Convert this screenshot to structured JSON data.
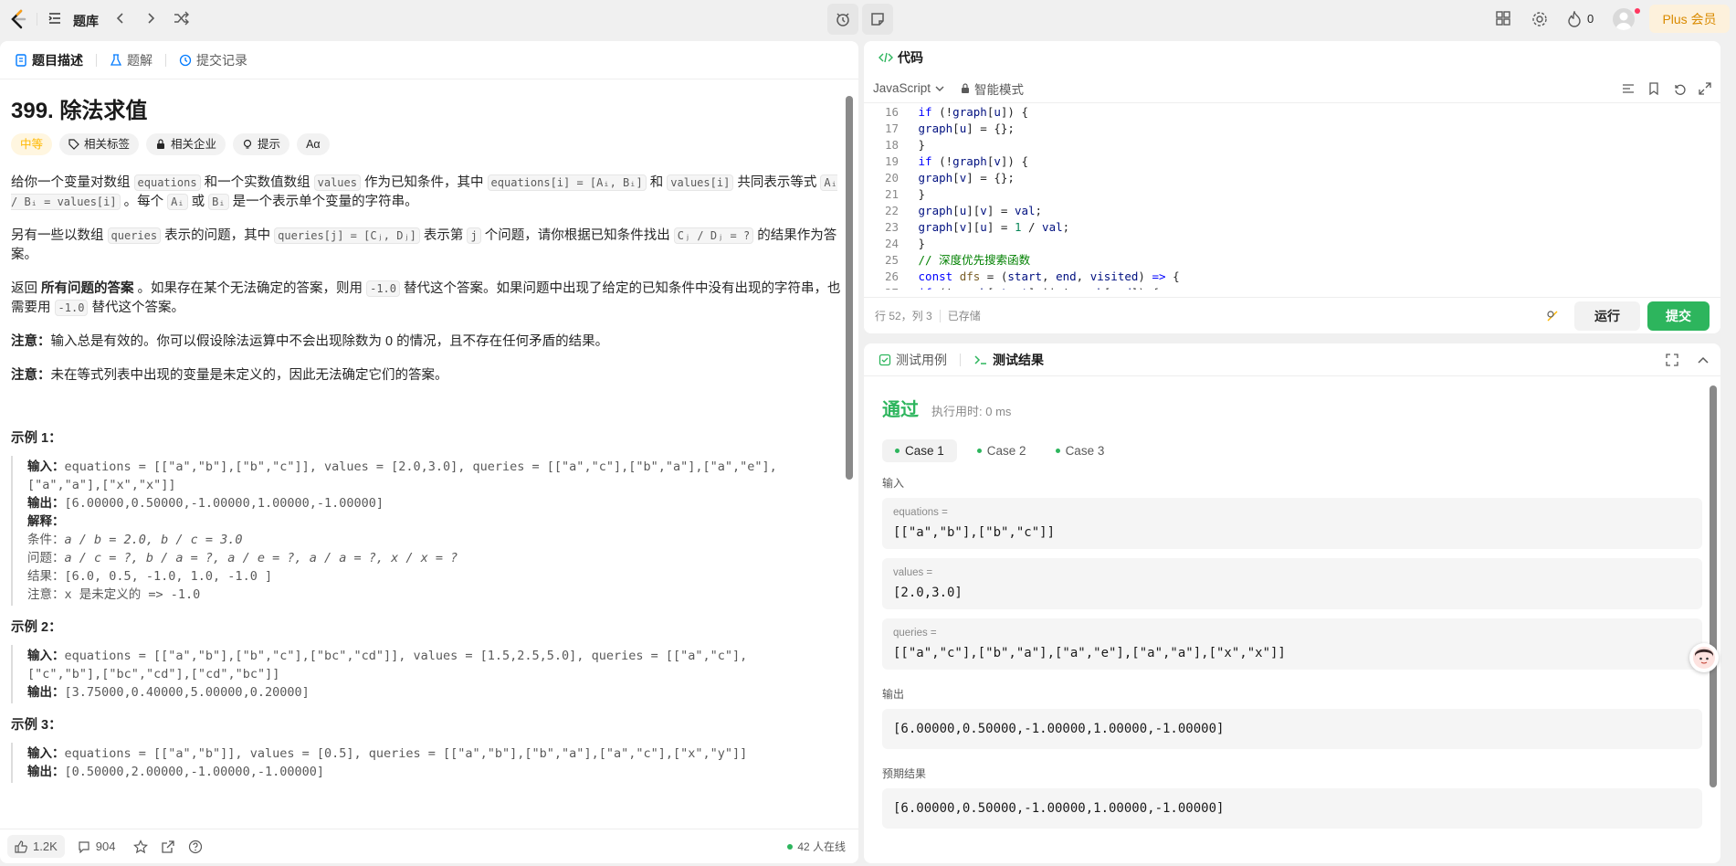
{
  "topbar": {
    "problem_list": "题库",
    "streak_count": "0",
    "premium": "Plus 会员"
  },
  "left": {
    "tabs": [
      "题目描述",
      "题解",
      "提交记录"
    ],
    "title": "399. 除法求值",
    "tags": [
      "中等",
      "相关标签",
      "相关企业",
      "提示",
      "Aα"
    ],
    "desc": {
      "p1_a": "给你一个变量对数组 ",
      "p1_b": "equations",
      "p1_c": " 和一个实数值数组 ",
      "p1_d": "values",
      "p1_e": " 作为已知条件，其中 ",
      "p1_f": "equations[i] = [Aᵢ, Bᵢ]",
      "p1_g": " 和 ",
      "p1_h": "values[i]",
      "p1_i": " 共同表示等式 ",
      "p1_j": "Aᵢ / Bᵢ = values[i]",
      "p1_k": " 。每个 ",
      "p1_l": "Aᵢ",
      "p1_m": " 或 ",
      "p1_n": "Bᵢ",
      "p1_o": " 是一个表示单个变量的字符串。",
      "p2_a": "另有一些以数组 ",
      "p2_b": "queries",
      "p2_c": " 表示的问题，其中 ",
      "p2_d": "queries[j] = [Cⱼ, Dⱼ]",
      "p2_e": " 表示第 ",
      "p2_f": "j",
      "p2_g": " 个问题，请你根据已知条件找出 ",
      "p2_h": "Cⱼ / Dⱼ = ?",
      "p2_i": " 的结果作为答案。",
      "p3_a": "返回 ",
      "p3_b": "所有问题的答案",
      "p3_c": " 。如果存在某个无法确定的答案，则用 ",
      "p3_d": "-1.0",
      "p3_e": " 替代这个答案。如果问题中出现了给定的已知条件中没有出现的字符串，也需要用 ",
      "p3_f": "-1.0",
      "p3_g": " 替代这个答案。",
      "note1_b": "注意：",
      "note1": "输入总是有效的。你可以假设除法运算中不会出现除数为 0 的情况，且不存在任何矛盾的结果。",
      "note2_b": "注意：",
      "note2": "未在等式列表中出现的变量是未定义的，因此无法确定它们的答案。"
    },
    "examples": [
      {
        "title": "示例 1：",
        "input_label": "输入：",
        "input": "equations = [[\"a\",\"b\"],[\"b\",\"c\"]], values = [2.0,3.0], queries = [[\"a\",\"c\"],[\"b\",\"a\"],[\"a\",\"e\"],",
        "input2": "[\"a\",\"a\"],[\"x\",\"x\"]]",
        "output_label": "输出：",
        "output": "[6.00000,0.50000,-1.00000,1.00000,-1.00000]",
        "expl_label": "解释：",
        "l1": "条件：",
        "l1v": "a / b = 2.0, b / c = 3.0",
        "l2": "问题：",
        "l2v": "a / c = ?, b / a = ?, a / e = ?, a / a = ?, x / x = ?",
        "l3": "结果：[6.0, 0.5, -1.0, 1.0, -1.0 ]",
        "l4": "注意：x 是未定义的 => -1.0"
      },
      {
        "title": "示例 2：",
        "input_label": "输入：",
        "input": "equations = [[\"a\",\"b\"],[\"b\",\"c\"],[\"bc\",\"cd\"]], values = [1.5,2.5,5.0], queries = [[\"a\",\"c\"],",
        "input2": "[\"c\",\"b\"],[\"bc\",\"cd\"],[\"cd\",\"bc\"]]",
        "output_label": "输出：",
        "output": "[3.75000,0.40000,5.00000,0.20000]"
      },
      {
        "title": "示例 3：",
        "input_label": "输入：",
        "input": "equations = [[\"a\",\"b\"]], values = [0.5], queries = [[\"a\",\"b\"],[\"b\",\"a\"],[\"a\",\"c\"],[\"x\",\"y\"]]",
        "output_label": "输出：",
        "output": "[0.50000,2.00000,-1.00000,-1.00000]"
      }
    ],
    "footer": {
      "likes": "1.2K",
      "comments": "904",
      "online": "42 人在线"
    }
  },
  "editor": {
    "tab": "代码",
    "language": "JavaScript",
    "mode": "智能模式",
    "status_pos": "行 52，列 3",
    "status_saved": "已存储",
    "run": "运行",
    "submit": "提交"
  },
  "results": {
    "tabs": [
      "测试用例",
      "测试结果"
    ],
    "status": "通过",
    "runtime": "执行用时: 0 ms",
    "cases": [
      "Case 1",
      "Case 2",
      "Case 3"
    ],
    "input_label": "输入",
    "params": [
      {
        "name": "equations =",
        "value": "[[\"a\",\"b\"],[\"b\",\"c\"]]"
      },
      {
        "name": "values =",
        "value": "[2.0,3.0]"
      },
      {
        "name": "queries =",
        "value": "[[\"a\",\"c\"],[\"b\",\"a\"],[\"a\",\"e\"],[\"a\",\"a\"],[\"x\",\"x\"]]"
      }
    ],
    "output_label": "输出",
    "output": "[6.00000,0.50000,-1.00000,1.00000,-1.00000]",
    "expected_label": "预期结果",
    "expected": "[6.00000,0.50000,-1.00000,1.00000,-1.00000]"
  },
  "colors": {
    "accent_green": "#2db55d",
    "medium": "#ffb800",
    "premium_bg": "#fdf1dc",
    "premium_fg": "#d98a00"
  }
}
